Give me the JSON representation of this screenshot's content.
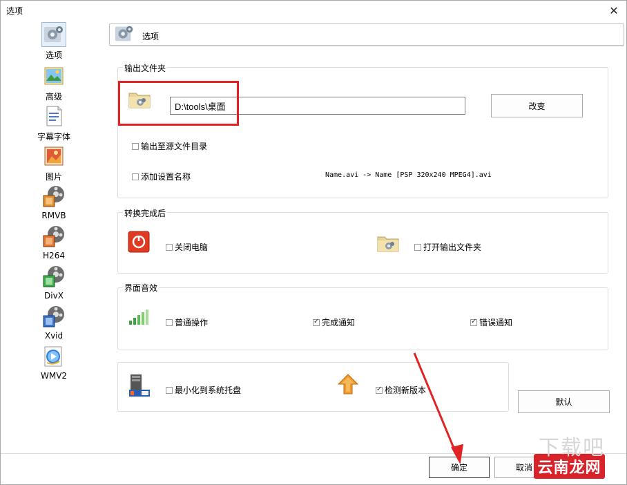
{
  "window": {
    "title": "选项",
    "close_glyph": "✕"
  },
  "sidebar": {
    "items": [
      {
        "label": "选项",
        "icon": "options-icon"
      },
      {
        "label": "高级",
        "icon": "advanced-icon"
      },
      {
        "label": "字幕字体",
        "icon": "subtitle-font-icon"
      },
      {
        "label": "图片",
        "icon": "picture-icon"
      },
      {
        "label": "RMVB",
        "icon": "rmvb-film-icon"
      },
      {
        "label": "H264",
        "icon": "h264-film-icon"
      },
      {
        "label": "DivX",
        "icon": "divx-film-icon"
      },
      {
        "label": "Xvid",
        "icon": "xvid-film-icon"
      },
      {
        "label": "WMV2",
        "icon": "wmv2-player-icon"
      }
    ]
  },
  "header": {
    "title": "选项"
  },
  "output_folder": {
    "title": "输出文件夹",
    "path_value": "D:\\tools\\桌面",
    "change_label": "改变",
    "to_source_dir_label": "输出至源文件目录",
    "add_setting_name_label": "添加设置名称",
    "name_example": "Name.avi   -> Name [PSP 320x240 MPEG4].avi"
  },
  "after_convert": {
    "title": "转换完成后",
    "shutdown_label": "关闭电脑",
    "open_output_label": "打开输出文件夹"
  },
  "sound": {
    "title": "界面音效",
    "normal_label": "普通操作",
    "normal_checked": false,
    "done_label": "完成通知",
    "done_checked": true,
    "error_label": "错误通知",
    "error_checked": true
  },
  "misc": {
    "minimize_tray_label": "最小化到系统托盘",
    "minimize_checked": false,
    "check_update_label": "检测新版本",
    "update_checked": true
  },
  "buttons": {
    "default_label": "默认",
    "ok_label": "确定",
    "cancel_label": "取消"
  },
  "watermark": {
    "text": "云南龙网",
    "faint": "下载吧"
  },
  "colors": {
    "annotation_red": "#e02424",
    "selection_blue": "#9fb7d6"
  }
}
